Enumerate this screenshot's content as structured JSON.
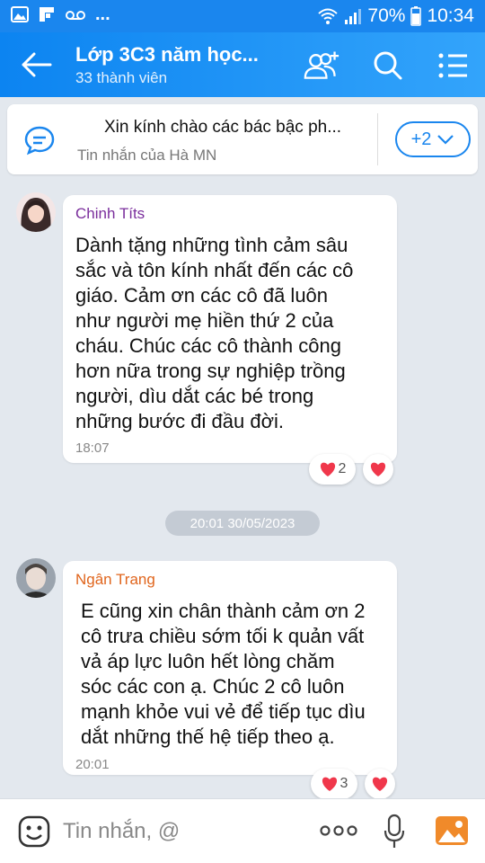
{
  "status_bar": {
    "overflow_dots": "...",
    "battery": "70%",
    "time": "10:34",
    "icons": [
      "gallery-icon",
      "flipboard-icon",
      "voicemail-icon",
      "wifi-icon",
      "signal-icon",
      "battery-icon"
    ]
  },
  "header": {
    "title": "Lớp 3C3 năm học...",
    "subtitle": "33 thành viên",
    "icons": [
      "back-arrow-icon",
      "add-member-icon",
      "search-icon",
      "menu-icon"
    ]
  },
  "pinned": {
    "text": "Xin kính chào các bác bậc ph...",
    "sender": "Tin nhắn của Hà MN",
    "more_label": "+2"
  },
  "messages": [
    {
      "name": "Chinh Títs",
      "name_color": "#7a2e9c",
      "lines": [
        "Dành tặng những tình cảm sâu",
        "sắc và tôn kính nhất đến các cô",
        "giáo. Cảm ơn các cô đã luôn",
        "như người mẹ hiền thứ 2 của",
        "cháu. Chúc các cô thành công",
        "hơn nữa trong sự nghiệp trồng",
        "người, dìu dắt các bé trong",
        "những bước đi đầu đời."
      ],
      "time": "18:07",
      "reaction_count": "2"
    },
    {
      "name": "Ngân Trang",
      "name_color": "#e0651d",
      "lines": [
        "E cũng xin chân thành cảm ơn 2",
        "cô trưa chiều sớm tối k quản vất",
        "vả áp lực luôn hết lòng chăm",
        "sóc các con ạ. Chúc 2 cô luôn",
        "mạnh khỏe vui vẻ để tiếp tục dìu",
        "dắt những thế hệ tiếp theo ạ."
      ],
      "time": "20:01",
      "reaction_count": "3"
    }
  ],
  "date_separator": "20:01 30/05/2023",
  "input": {
    "placeholder": "Tin nhắn, @",
    "icons": [
      "emoji-icon",
      "more-options-icon",
      "microphone-icon",
      "photo-icon"
    ]
  },
  "colors": {
    "accent": "#1a86ee",
    "heart": "#f0374b"
  }
}
